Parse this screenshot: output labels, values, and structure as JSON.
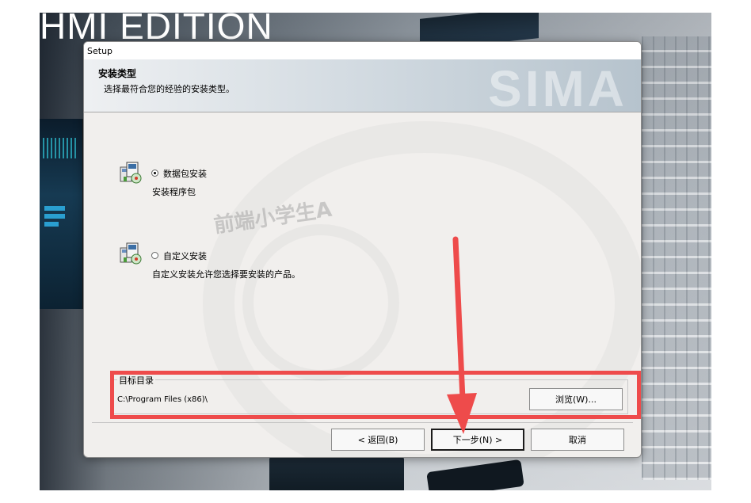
{
  "background": {
    "title": "HMI EDITION",
    "header_watermark": "SIMA"
  },
  "dialog": {
    "window_title": "Setup",
    "header": {
      "title": "安装类型",
      "subtitle": "选择最符合您的经验的安装类型。"
    },
    "options": [
      {
        "label": "数据包安装",
        "description": "安装程序包",
        "selected": true
      },
      {
        "label": "自定义安装",
        "description": "自定义安装允许您选择要安装的产品。",
        "selected": false
      }
    ],
    "target_directory": {
      "legend": "目标目录",
      "path": "C:\\Program Files (x86)\\",
      "browse_label": "浏览(W)..."
    },
    "buttons": {
      "back": "< 返回(B)",
      "next": "下一步(N) >",
      "cancel": "取消"
    }
  },
  "overlay_watermark": "前端小学生A",
  "colors": {
    "annotation_red": "#ee4b4b",
    "dialog_bg": "#f1efed",
    "header_gradient_end": "#b6c3cd"
  }
}
